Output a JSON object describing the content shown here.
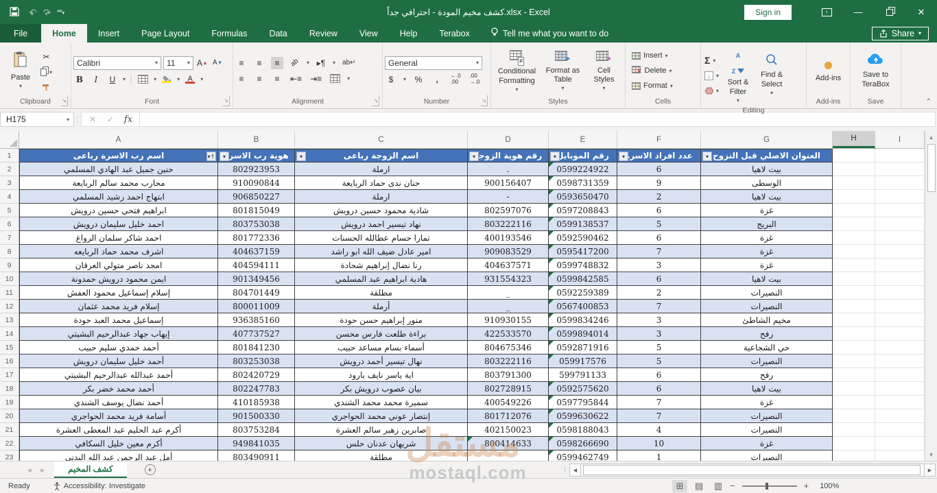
{
  "window": {
    "title": "كشف مخيم المودة - احترافي جداً.xlsx  -  Excel",
    "sign_in": "Sign in"
  },
  "ribbon_tabs": [
    {
      "id": "file",
      "label": "File",
      "active": false
    },
    {
      "id": "home",
      "label": "Home",
      "active": true
    },
    {
      "id": "insert",
      "label": "Insert",
      "active": false
    },
    {
      "id": "page-layout",
      "label": "Page Layout",
      "active": false
    },
    {
      "id": "formulas",
      "label": "Formulas",
      "active": false
    },
    {
      "id": "data",
      "label": "Data",
      "active": false
    },
    {
      "id": "review",
      "label": "Review",
      "active": false
    },
    {
      "id": "view",
      "label": "View",
      "active": false
    },
    {
      "id": "help",
      "label": "Help",
      "active": false
    },
    {
      "id": "terabox",
      "label": "Terabox",
      "active": false
    }
  ],
  "tell_me": "Tell me what you want to do",
  "share_label": "Share",
  "ribbon": {
    "groups": {
      "clipboard": "Clipboard",
      "font": "Font",
      "alignment": "Alignment",
      "number": "Number",
      "styles": "Styles",
      "cells": "Cells",
      "editing": "Editing",
      "addins": "Add-ins",
      "save": "Save"
    },
    "clipboard": {
      "paste": "Paste"
    },
    "font": {
      "name": "Calibri",
      "size": "11"
    },
    "number": {
      "format": "General"
    },
    "styles": {
      "conditional": "Conditional Formatting",
      "format_table": "Format as Table",
      "cell_styles": "Cell Styles"
    },
    "cells": {
      "insert": "Insert",
      "delete": "Delete",
      "format": "Format"
    },
    "editing": {
      "sort": "Sort & Filter",
      "find": "Find & Select"
    },
    "addins": {
      "label": "Add-ins"
    },
    "save": {
      "label": "Save to TeraBox"
    }
  },
  "formula_bar": {
    "name_box": "H175",
    "fx": "fx",
    "formula": ""
  },
  "grid": {
    "columns": [
      {
        "letter": "A",
        "selected": false
      },
      {
        "letter": "B",
        "selected": false
      },
      {
        "letter": "C",
        "selected": false
      },
      {
        "letter": "D",
        "selected": false
      },
      {
        "letter": "E",
        "selected": false
      },
      {
        "letter": "F",
        "selected": false
      },
      {
        "letter": "G",
        "selected": false
      },
      {
        "letter": "H",
        "selected": true
      },
      {
        "letter": "I",
        "selected": false
      }
    ],
    "headers": {
      "a": "اسم رب الاسرة رباعى",
      "b": "هوية رب الاسرة",
      "c": "اسم الزوجة رباعى",
      "d": "رقم هوية الزوجة",
      "e": "رقم الموبايل",
      "f": "عدد افراد الاسرة",
      "g": "العنوان الاصلي قبل النزوح"
    },
    "rows": [
      {
        "n": 2,
        "head": "حنين جميل عبد الهادي المسلمي",
        "hid": "802923953",
        "wife": "ارملة",
        "wid": ".",
        "mob": "0599224922",
        "fam": "6",
        "origin": "بيت لاهيا",
        "tm": true,
        "tw": false
      },
      {
        "n": 3,
        "head": "محارب محمد سالم الربايعة",
        "hid": "910090844",
        "wife": "حنان ندى حماد الربايعة",
        "wid": "900156407",
        "mob": "0598731359",
        "fam": "9",
        "origin": "الوسطى",
        "tm": true,
        "tw": false
      },
      {
        "n": 4,
        "head": "ابتهاج احمد رشيد المسلمي",
        "hid": "906850227",
        "wife": "ارملة",
        "wid": "-",
        "mob": "0593650470",
        "fam": "2",
        "origin": "بيت لاهيا",
        "tm": true,
        "tw": false
      },
      {
        "n": 5,
        "head": "ابراهيم فتحي حسين درويش",
        "hid": "801815049",
        "wife": "شادية محمود حسين درويش",
        "wid": "802597076",
        "mob": "0597208843",
        "fam": "6",
        "origin": "غزة",
        "tm": true,
        "tw": false
      },
      {
        "n": 6,
        "head": "احمد خليل سليمان درويش",
        "hid": "803753038",
        "wife": "نهاد تيسير احمد درويش",
        "wid": "803222116",
        "mob": "0599138537",
        "fam": "5",
        "origin": "البريج",
        "tm": true,
        "tw": false
      },
      {
        "n": 7,
        "head": "احمد شاكر سلمان الرواغ",
        "hid": "801772336",
        "wife": "تمارا حسام عطالله الحسنات",
        "wid": "400193546",
        "mob": "0592590462",
        "fam": "6",
        "origin": "غزة",
        "tm": true,
        "tw": false
      },
      {
        "n": 8,
        "head": "اشرف محمد حماد الربايعه",
        "hid": "404637159",
        "wife": "امير عادل ضيف الله ابو راشد",
        "wid": "909083529",
        "mob": "0595417200",
        "fam": "7",
        "origin": "غزة",
        "tm": true,
        "tw": false
      },
      {
        "n": 9,
        "head": "امجد ناصر متولي العرقان",
        "hid": "404594111",
        "wife": "رنا نضال إبراهيم شحادة",
        "wid": "404637571",
        "mob": "0599748832",
        "fam": "3",
        "origin": "غزة",
        "tm": true,
        "tw": false
      },
      {
        "n": 10,
        "head": "ايمن محمود درويش حمدونة",
        "hid": "901349456",
        "wife": "هادية ابراهيم عبد المسلمي",
        "wid": "931554323",
        "mob": "0599842585",
        "fam": "6",
        "origin": "بيت لاهيا",
        "tm": true,
        "tw": false
      },
      {
        "n": 11,
        "head": "إسلام إسماعيل محمود العفش",
        "hid": "804701449",
        "wife": "مطلقة",
        "wid": "_",
        "mob": "0592259389",
        "fam": "2",
        "origin": "النصيرات",
        "tm": true,
        "tw": false
      },
      {
        "n": 12,
        "head": "إسلام فريد محمد عثمان",
        "hid": "800011009",
        "wife": "أرملة",
        "wid": "_",
        "mob": "0567400853",
        "fam": "7",
        "origin": "النصيرات",
        "tm": true,
        "tw": false
      },
      {
        "n": 13,
        "head": "إسماعيل محمد العبد حودة",
        "hid": "936385160",
        "wife": "منور إبراهيم حسن حودة",
        "wid": "910930155",
        "mob": "0599834246",
        "fam": "3",
        "origin": "مخيم الشاطئ",
        "tm": true,
        "tw": false
      },
      {
        "n": 14,
        "head": "إيهاب جهاد عبدالرحيم البشيتي",
        "hid": "407737527",
        "wife": "براءة طلعت فارس محسن",
        "wid": "422533570",
        "mob": "0599894014",
        "fam": "3",
        "origin": "رفح",
        "tm": true,
        "tw": false
      },
      {
        "n": 15,
        "head": "أحمد حمدي سليم حبيب",
        "hid": "801841230",
        "wife": "أسماء بسام مساعد حبيب",
        "wid": "804675346",
        "mob": "0592871916",
        "fam": "5",
        "origin": "حي الشجاعية",
        "tm": true,
        "tw": false
      },
      {
        "n": 16,
        "head": "أحمد خليل سليمان درويش",
        "hid": "803253038",
        "wife": "نهال تيسير أحمد درويش",
        "wid": "803222116",
        "mob": "059917576",
        "fam": "5",
        "origin": "النصيرات",
        "tm": true,
        "tw": false
      },
      {
        "n": 17,
        "head": "أحمد عبدالله عبدالرحيم البشيتي",
        "hid": "802420729",
        "wife": "اية ياسر نايف بارود",
        "wid": "803791300",
        "mob": "599791133",
        "fam": "6",
        "origin": "رفح",
        "tm": false,
        "tw": false
      },
      {
        "n": 18,
        "head": "أحمد محمد خضر بكر",
        "hid": "802247783",
        "wife": "بيان عصوب درويش بكر",
        "wid": "802728915",
        "mob": "0592575620",
        "fam": "6",
        "origin": "بيت لاهيا",
        "tm": true,
        "tw": false
      },
      {
        "n": 19,
        "head": "أحمد نضال يوسف الشندي",
        "hid": "410185938",
        "wife": "سميرة محمد محمد الشندي",
        "wid": "400549226",
        "mob": "0597795844",
        "fam": "7",
        "origin": "غزة",
        "tm": true,
        "tw": false
      },
      {
        "n": 20,
        "head": "أسامة فريد محمد الحواجري",
        "hid": "901500330",
        "wife": "إنتصار عوني محمد الحواجري",
        "wid": "801712076",
        "mob": "0599630622",
        "fam": "7",
        "origin": "النصيرات",
        "tm": true,
        "tw": false
      },
      {
        "n": 21,
        "head": "أكرم عبد الحليم عبد المعطى العشرة",
        "hid": "803753284",
        "wife": "صابرين زهير سالم العشرة",
        "wid": "402150023",
        "mob": "0598188043",
        "fam": "4",
        "origin": "النصيرات",
        "tm": true,
        "tw": false
      },
      {
        "n": 22,
        "head": "أكرم معين خليل السكافي",
        "hid": "949841035",
        "wife": "شريهان عدنان حلس",
        "wid": "800414633",
        "mob": "0598266690",
        "fam": "10",
        "origin": "غزة",
        "tm": true,
        "tw": true
      },
      {
        "n": 23,
        "head": "أمل عبد الرحمن عبد الله البدني",
        "hid": "803490911",
        "wife": "مطلقة",
        "wid": "",
        "mob": "0599462749",
        "fam": "1",
        "origin": "النصيرات",
        "tm": true,
        "tw": false
      }
    ]
  },
  "sheet": {
    "tab": "كشف المخيم"
  },
  "status": {
    "ready": "Ready",
    "accessibility": "Accessibility: Investigate",
    "zoom": "100%"
  },
  "watermark": {
    "line1": "مستقل",
    "line2": "mostaql.com"
  }
}
